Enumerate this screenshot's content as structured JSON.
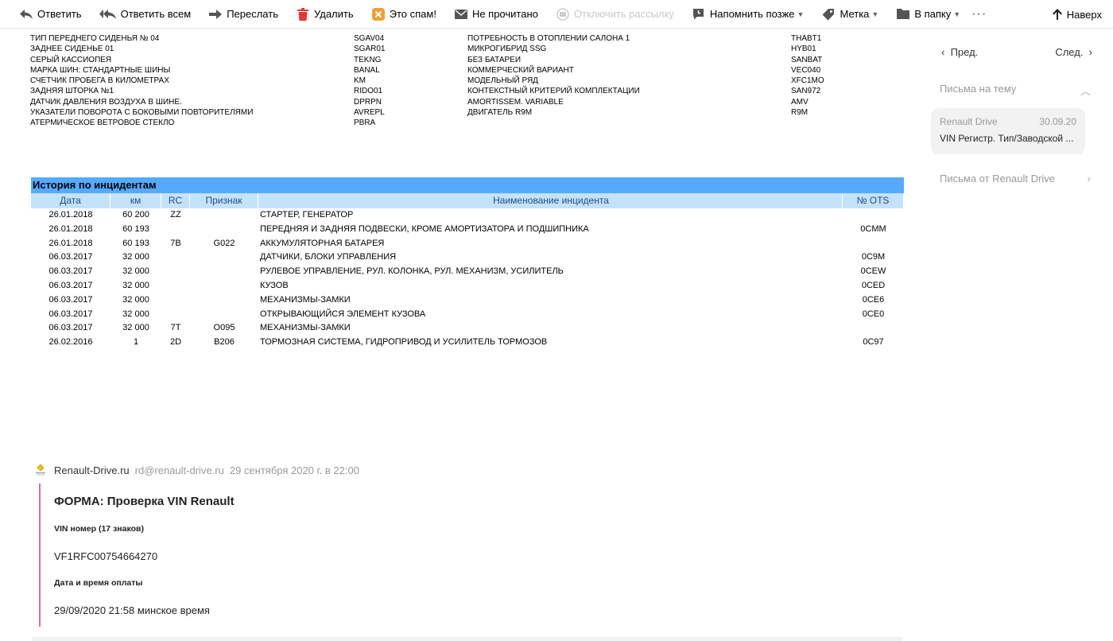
{
  "toolbar": {
    "reply": "Ответить",
    "reply_all": "Ответить всем",
    "forward": "Переслать",
    "delete": "Удалить",
    "spam": "Это спам!",
    "unread": "Не прочитано",
    "unsubscribe": "Отключить рассылку",
    "remind": "Напомнить позже",
    "label": "Метка",
    "to_folder": "В папку",
    "more": "···",
    "up": "Наверх"
  },
  "nav": {
    "prev": "Пред.",
    "next": "След."
  },
  "thread": {
    "title": "Письма на тему",
    "card_sender": "Renault Drive",
    "card_date": "30.09.20",
    "card_subject": "VIN Регистр. Тип/Заводской ..."
  },
  "from_link": "Письма от Renault Drive",
  "spec": {
    "col1": [
      "ТИП ПЕРЕДНЕГО СИДЕНЬЯ № 04",
      "ЗАДНЕЕ СИДЕНЬЕ 01",
      "СЕРЫЙ КАССИОПЕЯ",
      "МАРКА ШИН: СТАНДАРТНЫЕ ШИНЫ",
      "СЧЕТЧИК ПРОБЕГА В КИЛОМЕТРАХ",
      "ЗАДНЯЯ ШТОРКА №1",
      "ДАТЧИК ДАВЛЕНИЯ ВОЗДУХА В ШИНЕ.",
      "УКАЗАТЕЛИ ПОВОРОТА С БОКОВЫМИ ПОВТОРИТЕЛЯМИ",
      "АТЕРМИЧЕСКОЕ ВЕТРОВОЕ СТЕКЛО"
    ],
    "col2": [
      "SGAV04",
      "SGAR01",
      "TEKNG",
      "BANAL",
      "KM",
      "RIDO01",
      "DPRPN",
      "AVREPL",
      "PBRA"
    ],
    "col3": [
      "ПОТРЕБНОСТЬ В ОТОПЛЕНИИ САЛОНА 1",
      "МИКРОГИБРИД SSG",
      "БЕЗ БАТАРЕИ",
      "КОММЕРЧЕСКИЙ ВАРИАНТ",
      "МОДЕЛЬНЫЙ РЯД",
      "КОНТЕКСТНЫЙ КРИТЕРИЙ КОМПЛЕКТАЦИИ",
      "AMORTISSEM. VARIABLE",
      "ДВИГАТЕЛЬ R9M"
    ],
    "col4": [
      "THABT1",
      "HYB01",
      "SANBAT",
      "VEC040",
      "XFC1MO",
      "SAN972",
      "AMV",
      "R9M"
    ]
  },
  "incidents": {
    "title": "История по инцидентам",
    "headers": [
      "Дата",
      "км",
      "RC",
      "Признак",
      "Наименование инцидента",
      "№ OTS"
    ],
    "rows": [
      [
        "26.01.2018",
        "60 200",
        "ZZ",
        "",
        "СТАРТЕР, ГЕНЕРАТОР",
        ""
      ],
      [
        "26.01.2018",
        "60 193",
        "",
        "",
        "ПЕРЕДНЯЯ И ЗАДНЯЯ ПОДВЕСКИ, КРОМЕ АМОРТИЗАТОРА И ПОДШИПНИКА",
        "0CMM"
      ],
      [
        "26.01.2018",
        "60 193",
        "7B",
        "G022",
        "АККУМУЛЯТОРНАЯ БАТАРЕЯ",
        ""
      ],
      [
        "06.03.2017",
        "32 000",
        "",
        "",
        "ДАТЧИКИ, БЛОКИ УПРАВЛЕНИЯ",
        "0C9M"
      ],
      [
        "06.03.2017",
        "32 000",
        "",
        "",
        "РУЛЕВОЕ УПРАВЛЕНИЕ, РУЛ. КОЛОНКА, РУЛ. МЕХАНИЗМ, УСИЛИТЕЛЬ",
        "0CEW"
      ],
      [
        "06.03.2017",
        "32 000",
        "",
        "",
        "КУЗОВ",
        "0CED"
      ],
      [
        "06.03.2017",
        "32 000",
        "",
        "",
        "МЕХАНИЗМЫ-ЗАМКИ",
        "0CE6"
      ],
      [
        "06.03.2017",
        "32 000",
        "",
        "",
        "ОТКРЫВАЮЩИЙСЯ ЭЛЕМЕНТ КУЗОВА",
        "0CE0"
      ],
      [
        "06.03.2017",
        "32 000",
        "7T",
        "O095",
        "МЕХАНИЗМЫ-ЗАМКИ",
        ""
      ],
      [
        "26.02.2016",
        "1",
        "2D",
        "B206",
        "ТОРМОЗНАЯ СИСТЕМА, ГИДРОПРИВОД И УСИЛИТЕЛЬ ТОРМОЗОВ",
        "0C97"
      ]
    ]
  },
  "message": {
    "sender_name": "Renault-Drive.ru",
    "sender_email": "rd@renault-drive.ru",
    "date": "29 сентября 2020 г. в 22:00",
    "form_title": "ФОРМА: Проверка VIN Renault",
    "vin_label": "VIN номер (17 знаков)",
    "vin_value": "VF1RFC00754664270",
    "paid_label": "Дата и время оплаты",
    "paid_value": "29/09/2020 21:58 минское время"
  },
  "colors": {
    "incident_title_bg": "#55aaff",
    "incident_header_bg": "#c5e2fb",
    "quote_bar": "#d86ba6",
    "spam_icon": "#f0a030",
    "delete_icon": "#e53935"
  }
}
